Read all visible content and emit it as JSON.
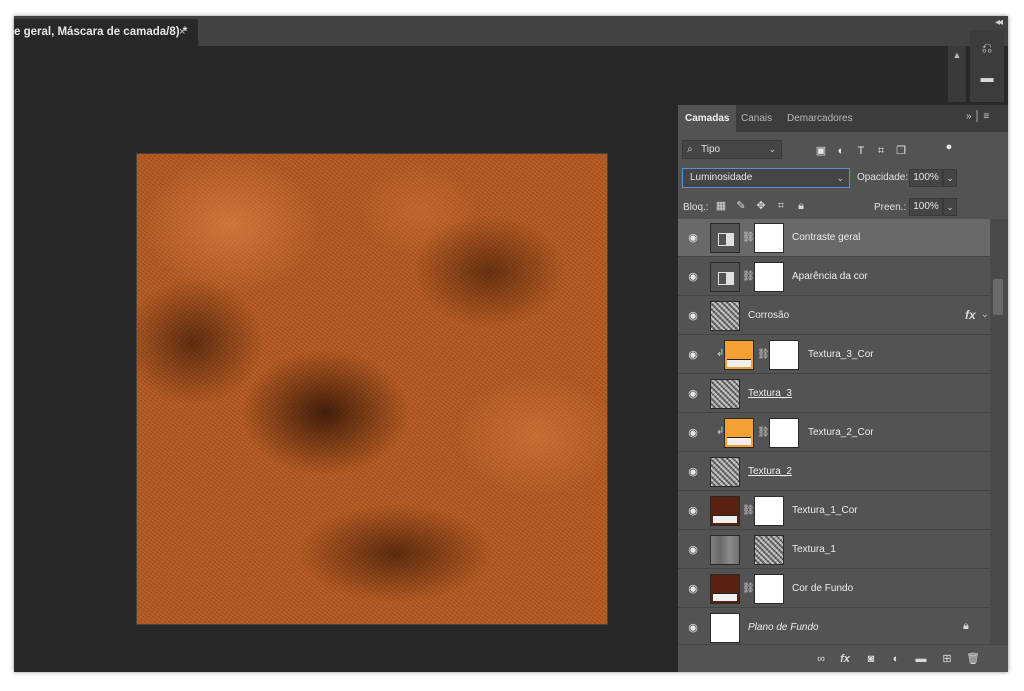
{
  "document_tab": {
    "title": "e geral, Máscara de camada/8) *",
    "close_glyph": "×"
  },
  "colors": {
    "accent": "#5a8fd6",
    "canvas_base": "#b55a22",
    "swatch_orange": "#f5a033",
    "swatch_brown": "#5a2010"
  },
  "panel": {
    "tabs": [
      {
        "label": "Camadas",
        "active": true
      },
      {
        "label": "Canais",
        "active": false
      },
      {
        "label": "Demarcadores",
        "active": false
      }
    ],
    "filter": {
      "kind_label": "Tipo",
      "icons": [
        "image-filter-icon",
        "adjustment-filter-icon",
        "type-filter-icon",
        "shape-filter-icon",
        "smart-object-filter-icon",
        "filter-toggle-icon"
      ]
    },
    "blend_mode": "Luminosidade",
    "opacity_label": "Opacidade:",
    "opacity_value": "100%",
    "lock_label": "Bloq.:",
    "fill_label": "Preen.:",
    "fill_value": "100%",
    "layers": [
      {
        "name": "Contraste geral",
        "selected": true,
        "thumb": "adjustment",
        "mask": true
      },
      {
        "name": "Aparência da cor",
        "selected": false,
        "thumb": "adjustment",
        "mask": true
      },
      {
        "name": "Corrosão",
        "selected": false,
        "thumb": "noise",
        "mask": false,
        "fx": true
      },
      {
        "name": "Textura_3_Cor",
        "selected": false,
        "thumb": "orange",
        "mask": true,
        "clipped": true
      },
      {
        "name": "Textura_3",
        "selected": false,
        "thumb": "noise",
        "mask": false,
        "underlined": true
      },
      {
        "name": "Textura_2_Cor",
        "selected": false,
        "thumb": "orange",
        "mask": true,
        "clipped": true
      },
      {
        "name": "Textura_2",
        "selected": false,
        "thumb": "noise",
        "mask": false,
        "underlined": true
      },
      {
        "name": "Textura_1_Cor",
        "selected": false,
        "thumb": "brown",
        "mask": true
      },
      {
        "name": "Textura_1",
        "selected": false,
        "thumb": "gray",
        "mask": true,
        "mask_noise": true
      },
      {
        "name": "Cor de Fundo",
        "selected": false,
        "thumb": "brown",
        "mask": true
      },
      {
        "name": "Plano de Fundo",
        "selected": false,
        "thumb": "white",
        "mask": false,
        "italic": true,
        "locked": true
      }
    ],
    "footer_icons": [
      "link-layers-icon",
      "fx-icon",
      "add-mask-icon",
      "adjustment-layer-icon",
      "group-folder-icon",
      "new-layer-icon",
      "trash-icon"
    ]
  }
}
